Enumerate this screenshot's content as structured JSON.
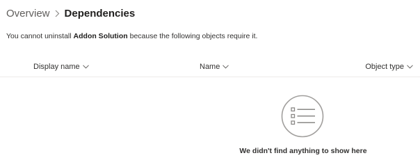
{
  "breadcrumb": {
    "parent": "Overview",
    "current": "Dependencies"
  },
  "message": {
    "prefix": "You cannot uninstall ",
    "solution_name": "Addon Solution",
    "suffix": " because the following objects require it."
  },
  "grid": {
    "columns": [
      {
        "label": "Display name",
        "icon": "chevron-down-icon"
      },
      {
        "label": "Name",
        "icon": "chevron-down-icon"
      },
      {
        "label": "Object type",
        "icon": "chevron-down-icon"
      }
    ],
    "rows": []
  },
  "empty_state": {
    "icon": "list-icon",
    "text": "We didn't find anything to show here"
  }
}
